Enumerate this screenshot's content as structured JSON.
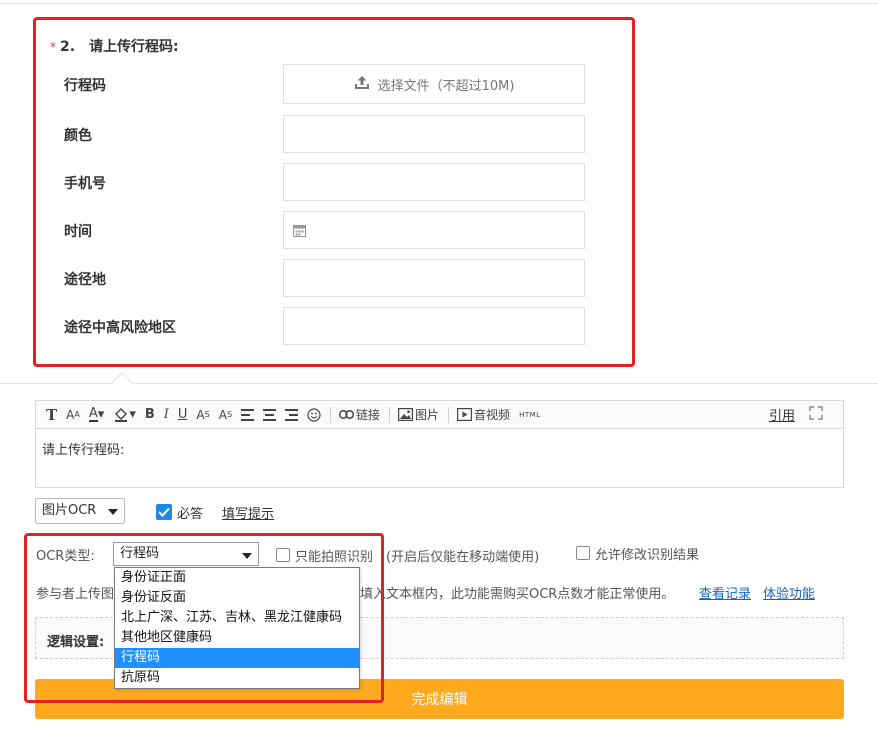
{
  "question": {
    "required_mark": "*",
    "number": "2.",
    "title": "请上传行程码:"
  },
  "fields": [
    {
      "label": "行程码",
      "type": "upload",
      "upload_text": "选择文件（不超过10M)"
    },
    {
      "label": "颜色",
      "type": "text"
    },
    {
      "label": "手机号",
      "type": "text"
    },
    {
      "label": "时间",
      "type": "date"
    },
    {
      "label": "途径地",
      "type": "text"
    },
    {
      "label": "途径中高风险地区",
      "type": "text"
    }
  ],
  "toolbar": {
    "link_label": "链接",
    "image_label": "图片",
    "video_label": "音视频",
    "html_label": "HTML",
    "quote_label": "引用"
  },
  "editor": {
    "content": "请上传行程码:"
  },
  "question_type": {
    "selected": "图片OCR",
    "required_label": "必答",
    "required_checked": true,
    "hint_link": "填写提示"
  },
  "ocr": {
    "type_label": "OCR类型:",
    "selected": "行程码",
    "only_photo_label": "只能拍照识别",
    "only_photo_note": "(开启后仅能在移动端使用)",
    "allow_modify_label": "允许修改识别结果",
    "desc_prefix": "参与者上传图",
    "desc_suffix": "填入文本框内，此功能需购买OCR点数才能正常使用。",
    "view_records": "查看记录",
    "try_feature": "体验功能",
    "options": [
      "身份证正面",
      "身份证反面",
      "北上广深、江苏、吉林、黑龙江健康码",
      "其他地区健康码",
      "行程码",
      "抗原码"
    ],
    "selected_index": 4
  },
  "logic": {
    "label": "逻辑设置:"
  },
  "done_button": "完成编辑",
  "colors": {
    "highlight_red": "#e81e25",
    "primary_orange": "#ffaa1e",
    "selection_blue": "#1e90ff",
    "link_blue": "#1565c0"
  }
}
